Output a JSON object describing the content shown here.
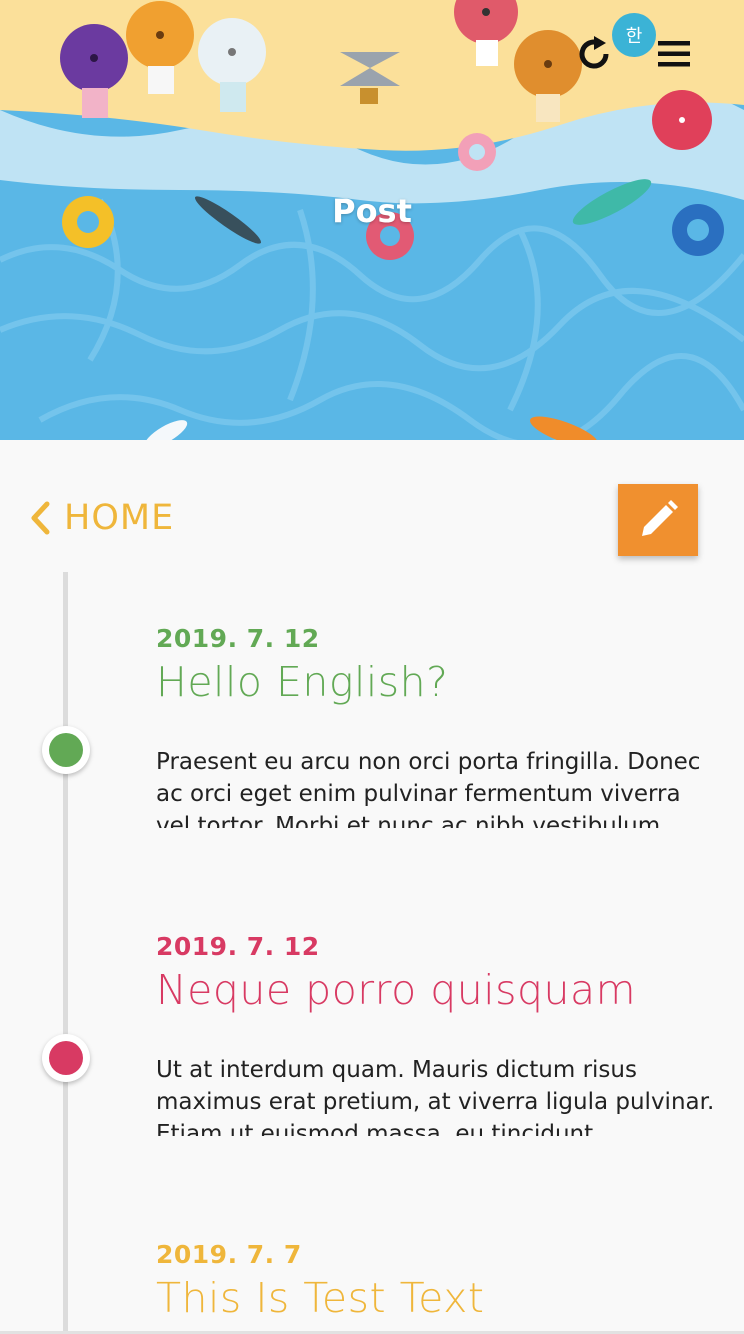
{
  "header": {
    "title": "Post",
    "language_badge": "한",
    "colors": {
      "sand": "#fbe09a",
      "water": "#5ab7e6",
      "foam": "#bfe3f4"
    }
  },
  "nav": {
    "home_label": "HOME",
    "accent": "#efb63b",
    "edit_button_color": "#f0902f",
    "icons": [
      "refresh-icon",
      "menu-icon",
      "chevron-left-icon",
      "pencil-icon"
    ]
  },
  "posts": [
    {
      "date": "2019. 7. 12",
      "title": "Hello English?",
      "body": "Praesent eu arcu non orci porta fringilla. Donec ac orci eget enim pulvinar fermentum viverra vel tortor. Morbi et nunc ac nibh vestibulum facilisis",
      "color": "#62a955"
    },
    {
      "date": "2019. 7. 12",
      "title": "Neque porro quisquam",
      "body": "Ut at interdum quam. Mauris dictum risus maximus erat pretium, at viverra ligula pulvinar. Etiam ut euismod massa, eu tincidunt",
      "color": "#d83a63"
    },
    {
      "date": "2019. 7. 7",
      "title": "This Is Test Text",
      "body": "",
      "color": "#efb63b"
    }
  ]
}
